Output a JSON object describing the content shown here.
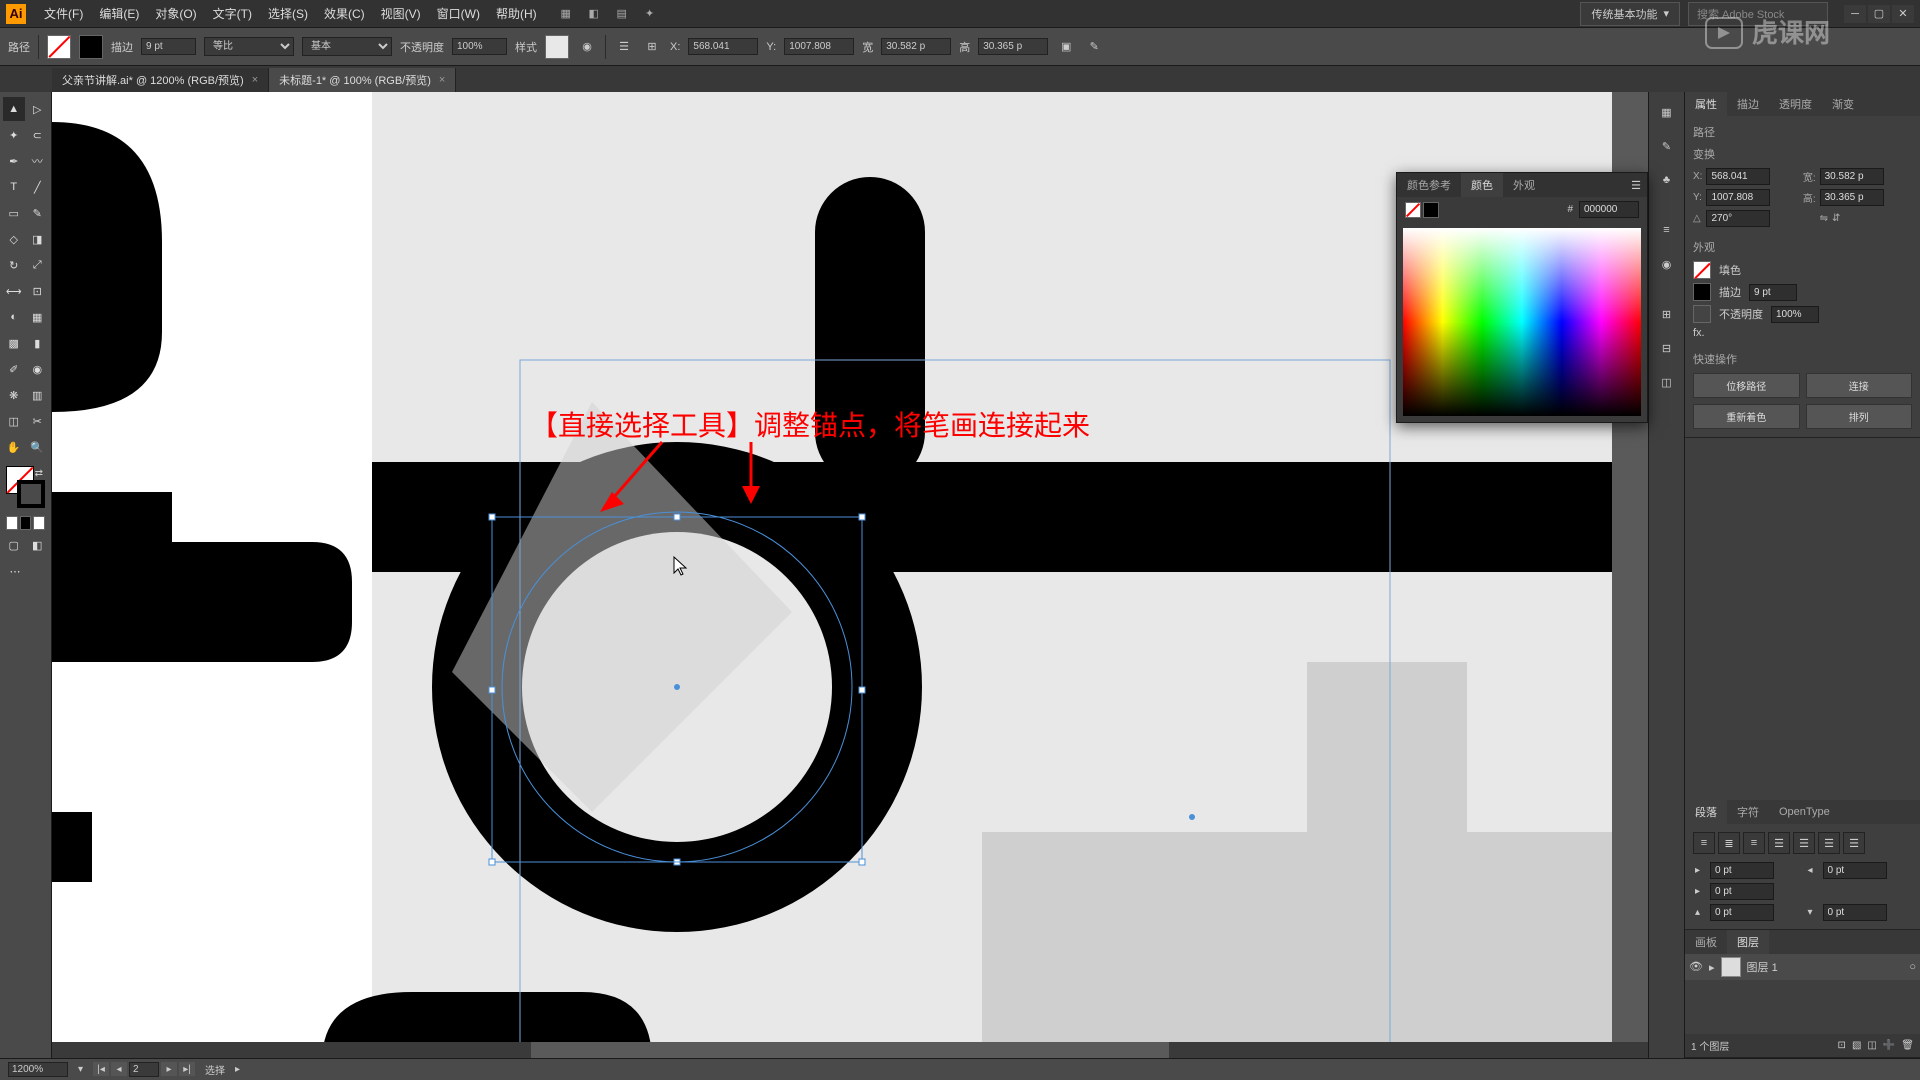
{
  "watermark": "虎课网",
  "menubar": {
    "logo": "Ai",
    "items": [
      "文件(F)",
      "编辑(E)",
      "对象(O)",
      "文字(T)",
      "选择(S)",
      "效果(C)",
      "视图(V)",
      "窗口(W)",
      "帮助(H)"
    ],
    "workspace": "传统基本功能",
    "search_placeholder": "搜索 Adobe Stock"
  },
  "control_bar": {
    "label": "路径",
    "stroke_label": "描边",
    "stroke_weight": "9 pt",
    "stroke_profile": "等比",
    "brush_profile": "基本",
    "opacity_label": "不透明度",
    "opacity": "100%",
    "style_label": "样式",
    "x": "568.041",
    "y": "1007.808",
    "w_label": "宽",
    "w": "30.582 p",
    "h_label": "高",
    "h": "30.365 p"
  },
  "tabs": [
    {
      "name": "父亲节讲解.ai* @ 1200% (RGB/预览)",
      "active": true
    },
    {
      "name": "未标题-1* @ 100% (RGB/预览)",
      "active": false
    }
  ],
  "annotation": "【直接选择工具】调整锚点，将笔画连接起来",
  "right": {
    "properties_tabs": [
      "属性",
      "描边",
      "透明度",
      "渐变"
    ],
    "path_label": "路径",
    "transform_label": "变换",
    "x": "568.041",
    "y": "1007.808",
    "w": "30.582 p",
    "h": "30.365 p",
    "rotation": "270°",
    "appearance_label": "外观",
    "fill_label": "填色",
    "stroke_label": "描边",
    "stroke_value": "9 pt",
    "opacity_label": "不透明度",
    "opacity_value": "100%",
    "fx_label": "fx.",
    "quick_label": "快速操作",
    "qa": [
      "位移路径",
      "连接",
      "重新着色",
      "排列"
    ]
  },
  "color_panel": {
    "tabs": [
      "颜色参考",
      "颜色",
      "外观"
    ],
    "hex": "000000"
  },
  "paragraph": {
    "tabs": [
      "段落",
      "字符",
      "OpenType"
    ],
    "indent_left": "0 pt",
    "indent_right": "0 pt",
    "indent_first": "0 pt",
    "space_before": "0 pt",
    "space_after": "0 pt"
  },
  "layers": {
    "tabs": [
      "画板",
      "图层"
    ],
    "layer_name": "图层 1",
    "footer": "1 个图层"
  },
  "statusbar": {
    "zoom": "1200%",
    "artboard_nav": "2",
    "tool": "选择"
  }
}
